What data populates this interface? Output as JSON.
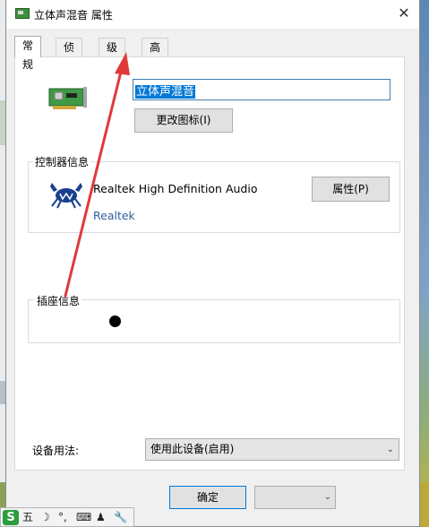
{
  "window": {
    "title": "立体声混音 属性",
    "close_glyph": "✕"
  },
  "tabs": [
    {
      "label": "常规"
    },
    {
      "label": "侦听"
    },
    {
      "label": "级别"
    },
    {
      "label": "高级"
    }
  ],
  "device": {
    "name_value": "立体声混音",
    "change_icon_button": "更改图标(I)"
  },
  "controller": {
    "group_label": "控制器信息",
    "name": "Realtek High Definition Audio",
    "vendor": "Realtek",
    "properties_button": "属性(P)"
  },
  "jack": {
    "group_label": "插座信息"
  },
  "usage": {
    "label": "设备用法:",
    "selected": "使用此设备(启用)"
  },
  "buttons": {
    "ok": "确定"
  },
  "ime": {
    "items": [
      "五",
      "☽",
      "°,",
      "⌨",
      "♟",
      "🔧"
    ]
  },
  "colors": {
    "accent": "#0078d7",
    "annotation_arrow": "#e03a3a"
  }
}
